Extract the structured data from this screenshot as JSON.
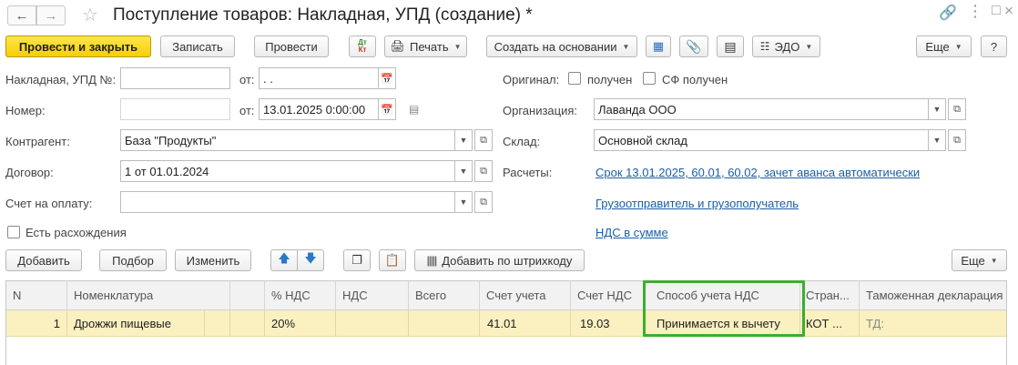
{
  "window": {
    "title": "Поступление товаров: Накладная, УПД (создание) *"
  },
  "toolbar": {
    "post_close": "Провести и закрыть",
    "save": "Записать",
    "post": "Провести",
    "print": "Печать",
    "create_based_on": "Создать на основании",
    "edo": "ЭДО",
    "more": "Еще",
    "help": "?",
    "dt_kt": "Дт\nКт"
  },
  "form": {
    "invoice_label": "Накладная, УПД №:",
    "invoice_value": "",
    "from_label": "от:",
    "invoice_date": " .  .",
    "number_label": "Номер:",
    "number_value": "",
    "from_label2": "от:",
    "date_value": "13.01.2025  0:00:00",
    "contractor_label": "Контрагент:",
    "contractor_value": "База \"Продукты\"",
    "contract_label": "Договор:",
    "contract_value": "1 от 01.01.2024",
    "payment_invoice_label": "Счет на оплату:",
    "payment_invoice_value": "",
    "discrepancy_label": "Есть расхождения",
    "original_label": "Оригинал:",
    "received_label": "получен",
    "sf_received_label": "СФ получен",
    "organization_label": "Организация:",
    "organization_value": "Лаванда ООО",
    "warehouse_label": "Склад:",
    "warehouse_value": "Основной склад",
    "settlements_label": "Расчеты:",
    "settlements_link": "Срок 13.01.2025, 60.01, 60.02, зачет аванса автоматически",
    "shipper_link": "Грузоотправитель и грузополучатель",
    "vat_link": "НДС в сумме"
  },
  "table_toolbar": {
    "add": "Добавить",
    "pick": "Подбор",
    "edit": "Изменить",
    "barcode": "Добавить по штрихкоду",
    "more": "Еще"
  },
  "table": {
    "headers": {
      "n": "N",
      "item": "Номенклатура",
      "blank": "",
      "vat_rate": "% НДС",
      "vat": "НДС",
      "total": "Всего",
      "account": "Счет учета",
      "vat_account": "Счет НДС",
      "vat_method": "Способ учета НДС",
      "country": "Стран...",
      "customs": "Таможенная декларация и..."
    },
    "rows": [
      {
        "n": "1",
        "item": "Дрожжи пищевые",
        "blank": "",
        "vat_rate": "20%",
        "vat": "",
        "total": "",
        "account": "41.01",
        "vat_account": "19.03",
        "vat_method": "Принимается к вычету",
        "country": "КОТ ...",
        "customs": "ТД:"
      }
    ]
  },
  "colors": {
    "primary_button": "#f5cf05",
    "link": "#1a5ea8",
    "selected_row": "#faf0c0",
    "highlight_border": "#3cae2e"
  }
}
